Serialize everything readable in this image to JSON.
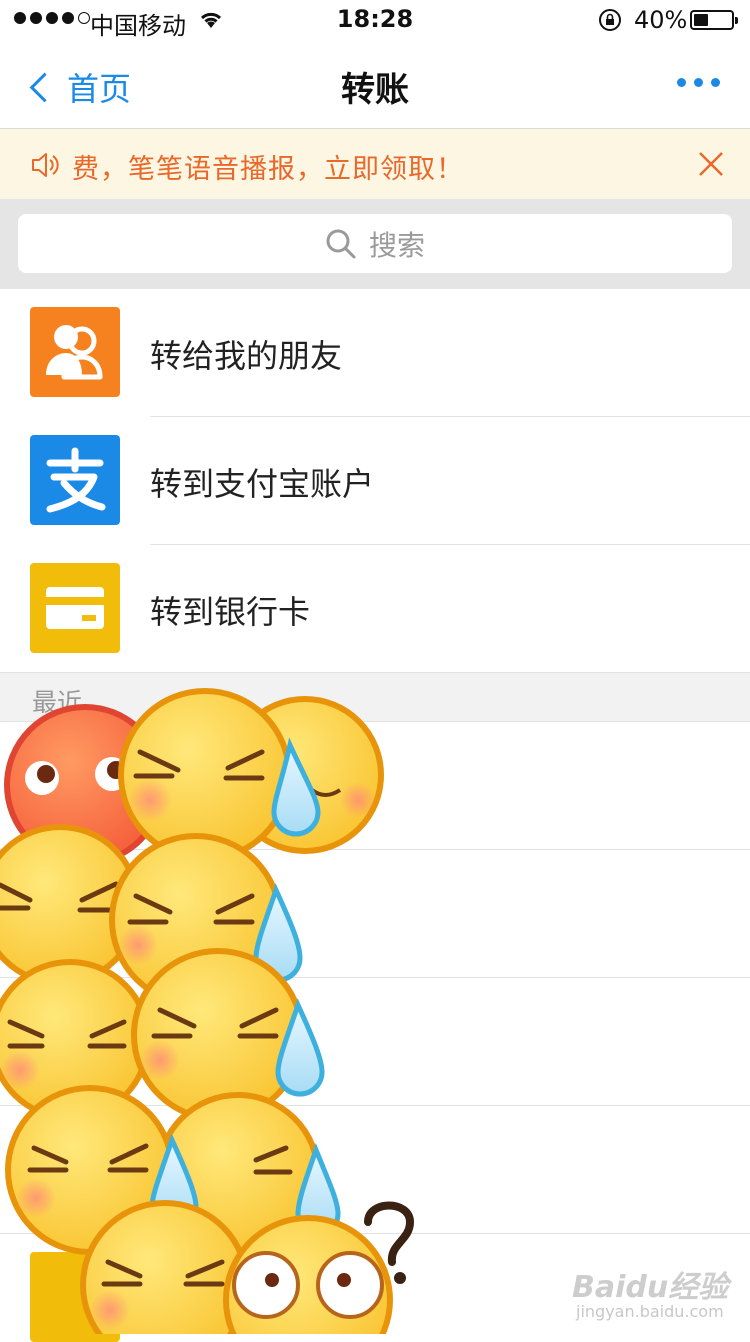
{
  "status_bar": {
    "carrier": "中国移动",
    "time": "18:28",
    "battery_percent": "40%",
    "battery_level": 0.4,
    "signal_bars": 4
  },
  "nav": {
    "back_label": "首页",
    "title": "转账"
  },
  "notice": {
    "text": "费，笔笔语音播报，立即领取！",
    "color": "#e8692a"
  },
  "search": {
    "placeholder": "搜索"
  },
  "menu": [
    {
      "label": "转给我的朋友",
      "icon": "friends-icon",
      "color": "#f5821f"
    },
    {
      "label": "转到支付宝账户",
      "icon": "alipay-icon",
      "color": "#1a8ae6"
    },
    {
      "label": "转到银行卡",
      "icon": "bank-card-icon",
      "color": "#f1bd0a"
    }
  ],
  "recent": {
    "header": "最近"
  },
  "watermark": {
    "brand": "Baidu经验",
    "url": "jingyan.baidu.com"
  },
  "colors": {
    "accent": "#1a8ae6",
    "notice_bg": "#fdf6e2"
  }
}
